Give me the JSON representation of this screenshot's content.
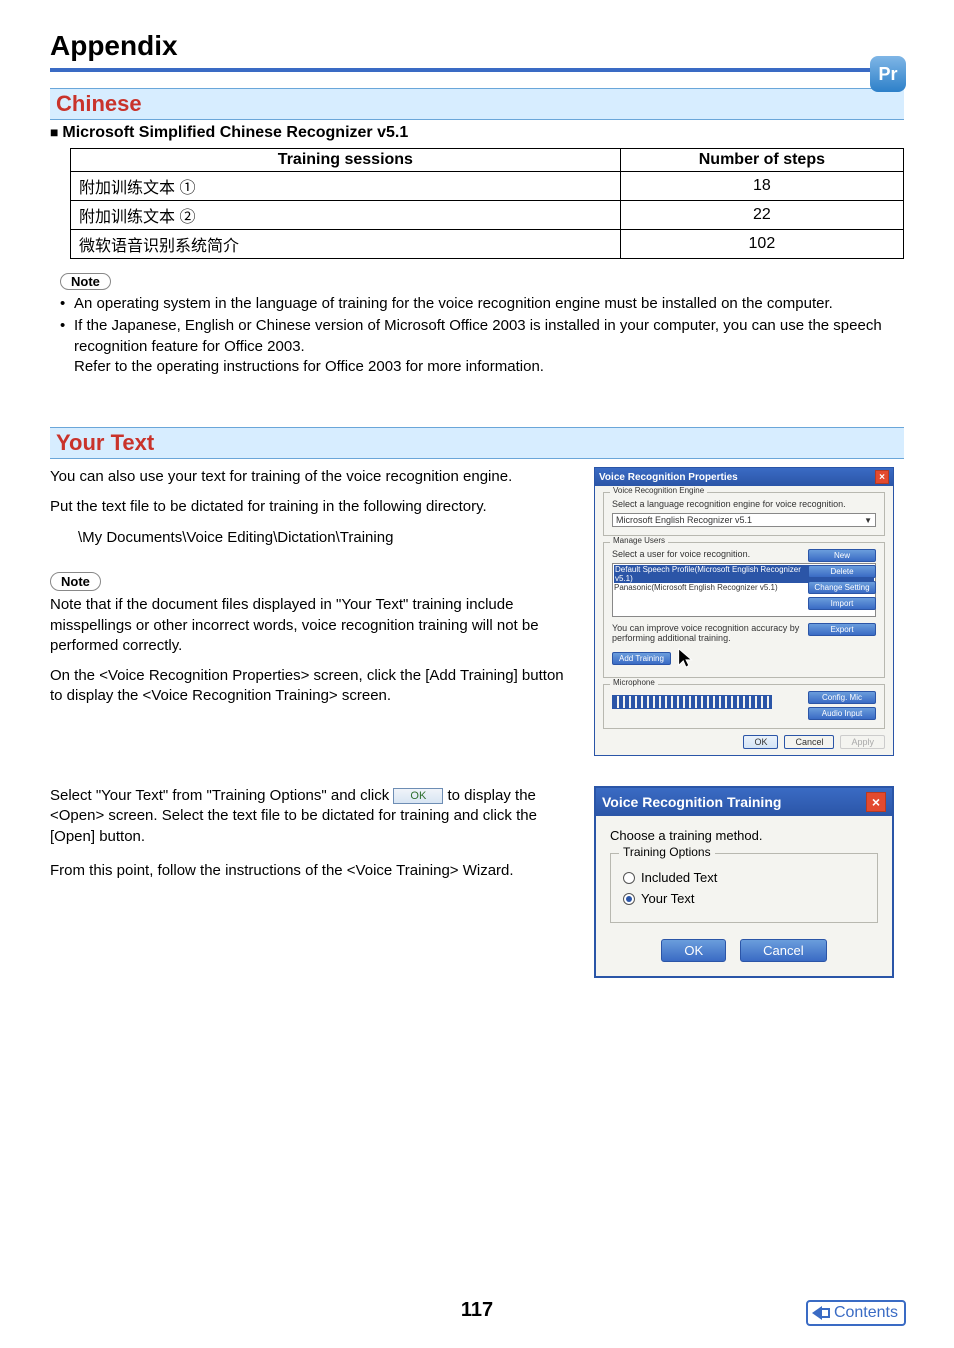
{
  "page_title": "Appendix",
  "top_icon": "Pr",
  "chinese_section": {
    "heading": "Chinese",
    "sub_heading": "Microsoft Simplified Chinese Recognizer v5.1",
    "table": {
      "col_training": "Training sessions",
      "col_steps": "Number of steps",
      "rows": [
        {
          "session": "附加训练文本 ①",
          "steps": "18"
        },
        {
          "session": "附加训练文本 ②",
          "steps": "22"
        },
        {
          "session": "微软语音识别系统简介",
          "steps": "102"
        }
      ]
    },
    "note_label": "Note",
    "notes": [
      "An operating system in the language of training for the voice recognition engine must be installed on the computer.",
      "If the Japanese, English or Chinese version of Microsoft Office 2003 is installed in your computer, you can use the speech recognition feature for Office 2003.",
      "Refer to the operating instructions for Office 2003 for more information."
    ]
  },
  "your_text_section": {
    "heading": "Your Text",
    "p1": "You can also use your text for training of the voice recognition engine.",
    "p2": "Put the text file to be dictated for training in the following directory.",
    "path": "\\My Documents\\Voice Editing\\Dictation\\Training",
    "note_label": "Note",
    "note_body": "Note that if the document files displayed in \"Your Text\" training include misspellings or other incorrect words, voice recognition training will not be performed correctly.",
    "p3": "On the <Voice Recognition Properties> screen, click the [Add Training] button to display the <Voice Recognition Training> screen.",
    "p4a": "Select \"Your Text\" from \"Training Options\" and click ",
    "p4b": " to display the <Open> screen. Select the text file to be dictated for training and click the [Open] button.",
    "ok_inline": "OK",
    "p5": "From this point, follow the instructions of the <Voice Training> Wizard."
  },
  "dialog_props": {
    "title": "Voice Recognition Properties",
    "engine_legend": "Voice Recognition Engine",
    "engine_desc": "Select a language recognition engine for voice recognition.",
    "engine_value": "Microsoft English Recognizer v5.1",
    "users_legend": "Manage Users",
    "users_desc": "Select a user for voice recognition.",
    "list_selected": "Default Speech Profile(Microsoft English Recognizer v5.1)",
    "list_item2": "Panasonic(Microsoft English Recognizer v5.1)",
    "improve_text": "You can improve voice recognition accuracy by performing additional training.",
    "btn_new": "New",
    "btn_delete": "Delete",
    "btn_change": "Change Setting",
    "btn_import": "Import",
    "btn_export": "Export",
    "btn_add_training": "Add Training",
    "mic_legend": "Microphone",
    "btn_config_mic": "Config. Mic",
    "btn_audio_input": "Audio Input",
    "btn_ok": "OK",
    "btn_cancel": "Cancel",
    "btn_apply": "Apply"
  },
  "dialog_training": {
    "title": "Voice Recognition Training",
    "choose_label": "Choose a training method.",
    "fs_legend": "Training Options",
    "opt_included": "Included Text",
    "opt_your": "Your Text",
    "btn_ok": "OK",
    "btn_cancel": "Cancel"
  },
  "page_number": "117",
  "contents_label": "Contents"
}
